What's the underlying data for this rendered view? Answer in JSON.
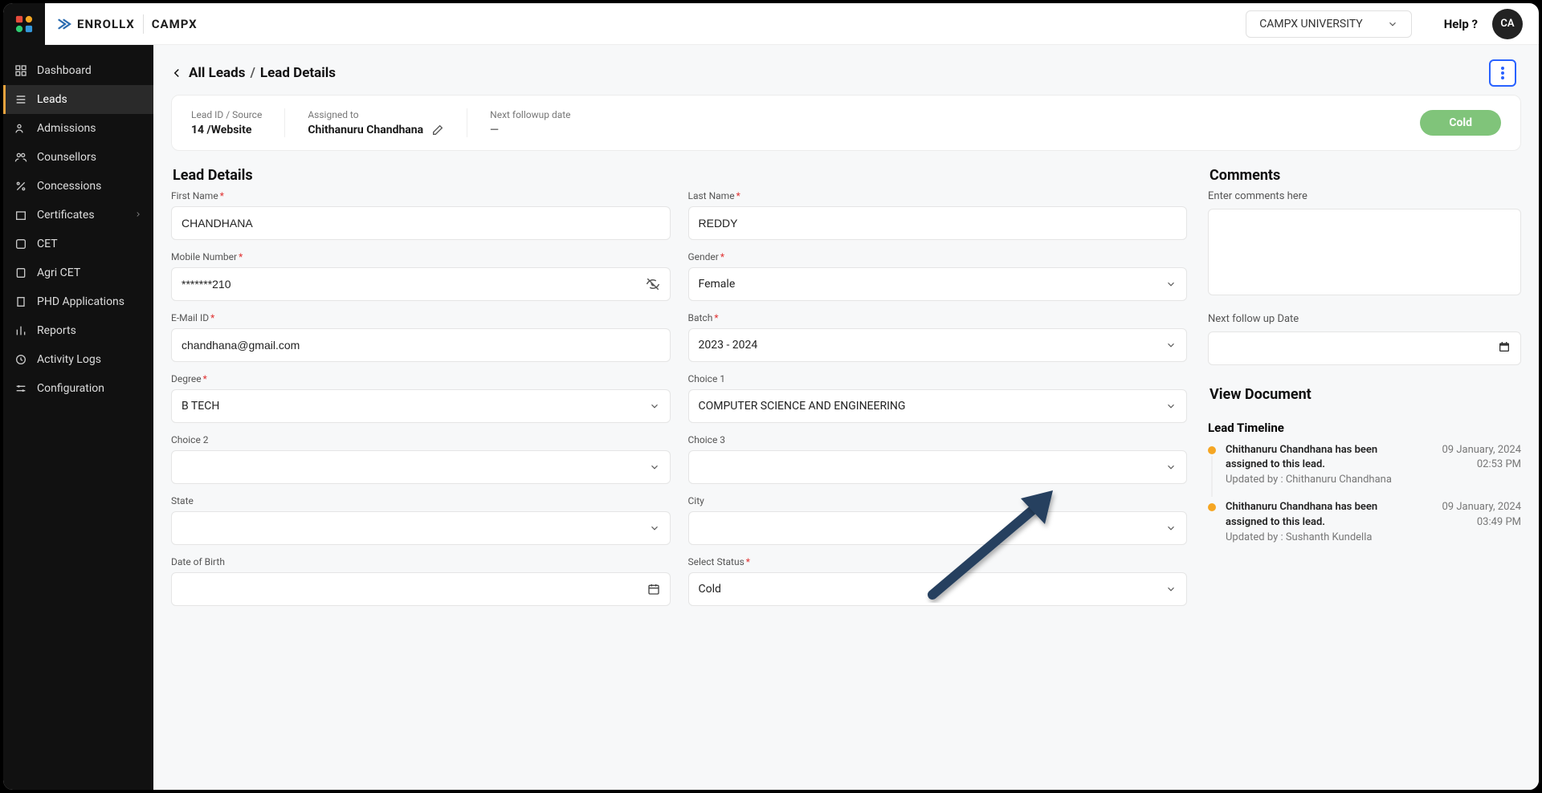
{
  "brand": {
    "app1": "ENROLLX",
    "app2": "CAMPX"
  },
  "top": {
    "university": "CAMPX UNIVERSITY",
    "help": "Help ?",
    "avatar": "CA"
  },
  "sidebar": {
    "items": [
      {
        "label": "Dashboard"
      },
      {
        "label": "Leads"
      },
      {
        "label": "Admissions"
      },
      {
        "label": "Counsellors"
      },
      {
        "label": "Concessions"
      },
      {
        "label": "Certificates"
      },
      {
        "label": "CET"
      },
      {
        "label": "Agri CET"
      },
      {
        "label": "PHD Applications"
      },
      {
        "label": "Reports"
      },
      {
        "label": "Activity Logs"
      },
      {
        "label": "Configuration"
      }
    ]
  },
  "crumb": {
    "all": "All Leads",
    "sep": "/",
    "current": "Lead Details"
  },
  "summary": {
    "leadid_label": "Lead ID / Source",
    "leadid_value": "14 /Website",
    "assigned_label": "Assigned to",
    "assigned_value": "Chithanuru Chandhana",
    "followup_label": "Next followup date",
    "followup_value": "—",
    "status_pill": "Cold"
  },
  "lead_details": {
    "title": "Lead Details",
    "fields": {
      "first_name": {
        "label": "First Name",
        "value": "CHANDHANA"
      },
      "last_name": {
        "label": "Last Name",
        "value": "REDDY"
      },
      "mobile": {
        "label": "Mobile Number",
        "value": "*******210"
      },
      "gender": {
        "label": "Gender",
        "value": "Female"
      },
      "email": {
        "label": "E-Mail ID",
        "value": "chandhana@gmail.com"
      },
      "batch": {
        "label": "Batch",
        "value": "2023 - 2024"
      },
      "degree": {
        "label": "Degree",
        "value": "B TECH"
      },
      "choice1": {
        "label": "Choice 1",
        "value": "COMPUTER SCIENCE AND ENGINEERING"
      },
      "choice2": {
        "label": "Choice 2",
        "value": ""
      },
      "choice3": {
        "label": "Choice 3",
        "value": ""
      },
      "state": {
        "label": "State",
        "value": ""
      },
      "city": {
        "label": "City",
        "value": ""
      },
      "dob": {
        "label": "Date of Birth",
        "value": ""
      },
      "status": {
        "label": "Select Status",
        "value": "Cold"
      }
    }
  },
  "comments": {
    "title": "Comments",
    "placeholder": "Enter comments here",
    "next_followup_label": "Next follow up Date"
  },
  "view_doc": {
    "title": "View Document"
  },
  "timeline": {
    "title": "Lead Timeline",
    "items": [
      {
        "msg": "Chithanuru Chandhana has been assigned to this lead.",
        "upd": "Updated by : Chithanuru Chandhana",
        "date1": "09 January, 2024",
        "date2": "02:53 PM"
      },
      {
        "msg": "Chithanuru Chandhana has been assigned to this lead.",
        "upd": "Updated by : Sushanth Kundella",
        "date1": "09 January, 2024",
        "date2": "03:49 PM"
      }
    ]
  }
}
